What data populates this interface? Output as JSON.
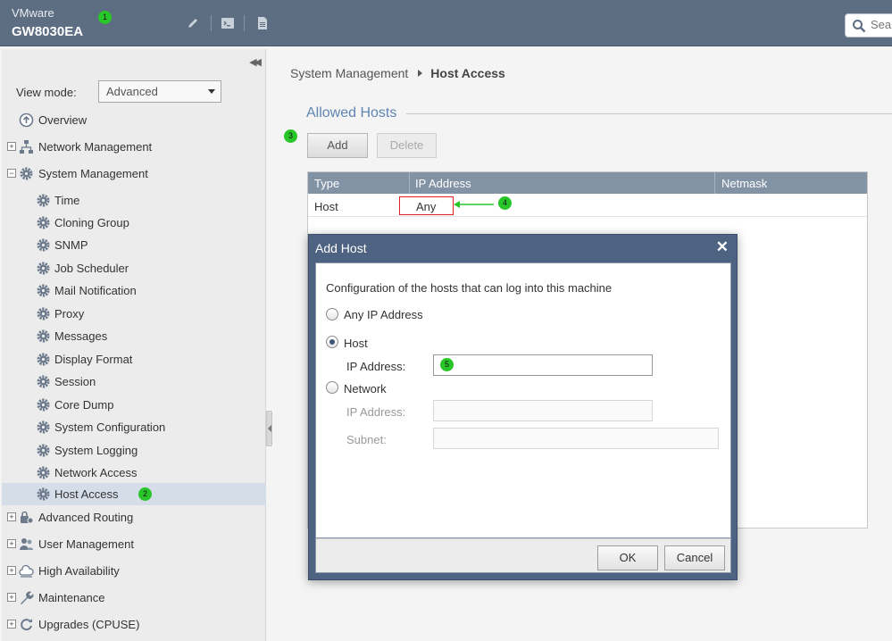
{
  "header": {
    "vendor": "VMware",
    "hostname": "GW8030EA",
    "search_placeholder": "Sear",
    "tools": [
      "pencil-icon",
      "terminal-icon",
      "document-icon"
    ]
  },
  "annotations": [
    "1",
    "2",
    "3",
    "4",
    "5"
  ],
  "sidebar": {
    "view_mode_label": "View mode:",
    "view_mode_value": "Advanced",
    "items": [
      {
        "label": "Overview",
        "icon": "overview-icon"
      },
      {
        "label": "Network Management",
        "icon": "network-icon"
      },
      {
        "label": "System Management",
        "icon": "gear-icon"
      },
      {
        "label": "Time",
        "icon": "gear-icon"
      },
      {
        "label": "Cloning Group",
        "icon": "gear-icon"
      },
      {
        "label": "SNMP",
        "icon": "gear-icon"
      },
      {
        "label": "Job Scheduler",
        "icon": "gear-icon"
      },
      {
        "label": "Mail Notification",
        "icon": "gear-icon"
      },
      {
        "label": "Proxy",
        "icon": "gear-icon"
      },
      {
        "label": "Messages",
        "icon": "gear-icon"
      },
      {
        "label": "Display Format",
        "icon": "gear-icon"
      },
      {
        "label": "Session",
        "icon": "gear-icon"
      },
      {
        "label": "Core Dump",
        "icon": "gear-icon"
      },
      {
        "label": "System Configuration",
        "icon": "gear-icon"
      },
      {
        "label": "System Logging",
        "icon": "gear-icon"
      },
      {
        "label": "Network Access",
        "icon": "gear-icon"
      },
      {
        "label": "Host Access",
        "icon": "gear-icon"
      },
      {
        "label": "Advanced Routing",
        "icon": "routing-icon"
      },
      {
        "label": "User Management",
        "icon": "users-icon"
      },
      {
        "label": "High Availability",
        "icon": "cloud-icon"
      },
      {
        "label": "Maintenance",
        "icon": "wrench-icon"
      },
      {
        "label": "Upgrades (CPUSE)",
        "icon": "refresh-icon"
      }
    ]
  },
  "main": {
    "breadcrumb_parent": "System Management",
    "breadcrumb_current": "Host Access",
    "section_title": "Allowed Hosts",
    "add_label": "Add",
    "delete_label": "Delete",
    "columns": [
      "Type",
      "IP Address",
      "Netmask"
    ],
    "rows": [
      {
        "type": "Host",
        "ip": "Any",
        "netmask": ""
      }
    ]
  },
  "dialog": {
    "title": "Add Host",
    "description": "Configuration of the hosts that can log into this machine",
    "opt_any": "Any IP Address",
    "opt_host": "Host",
    "opt_network": "Network",
    "host_ip_label": "IP Address:",
    "net_ip_label": "IP Address:",
    "subnet_label": "Subnet:",
    "host_ip_value": "",
    "ok_label": "OK",
    "cancel_label": "Cancel",
    "selected": "host"
  },
  "colors": {
    "header_bg": "#5e6e82",
    "accent_title": "#5f86b3",
    "grid_header": "#8393a6",
    "dialog_frame": "#4e6282",
    "badge": "#29c629",
    "highlight": "#e02020"
  }
}
